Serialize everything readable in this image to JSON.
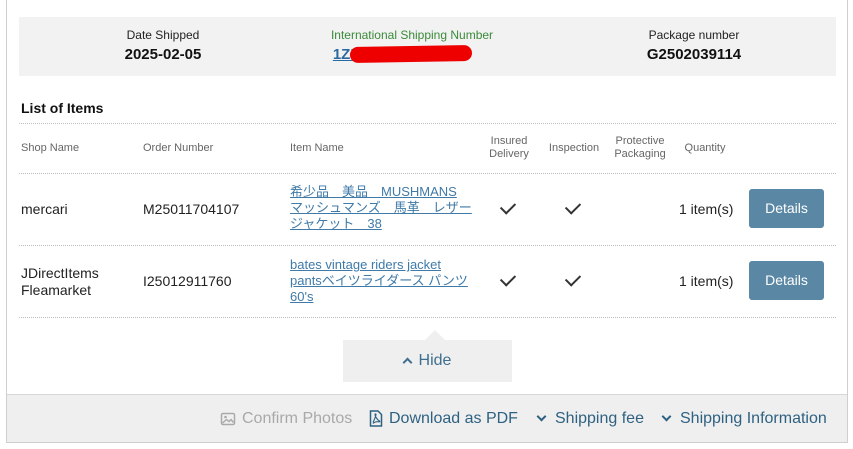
{
  "summary": {
    "date_label": "Date Shipped",
    "date_value": "2025-02-05",
    "intl_label": "International Shipping Number",
    "intl_value": "1ZR",
    "pkg_label": "Package number",
    "pkg_value": "G2502039114"
  },
  "list": {
    "title": "List of Items",
    "headers": {
      "shop": "Shop Name",
      "order": "Order Number",
      "item": "Item Name",
      "insured_1": "Insured",
      "insured_2": "Delivery",
      "inspection": "Inspection",
      "protective_1": "Protective",
      "protective_2": "Packaging",
      "quantity": "Quantity"
    },
    "rows": [
      {
        "shop": "mercari",
        "shop_2": "",
        "order": "M25011704107",
        "item_1": "希少品　美品　MUSHMANS",
        "item_2": "マッシュマンズ　馬革　レザー",
        "item_3": "ジャケット　38",
        "quantity": "1 item(s)",
        "details": "Details"
      },
      {
        "shop": "JDirectItems",
        "shop_2": "Fleamarket",
        "order": "I25012911760",
        "item_1": "bates vintage riders jacket",
        "item_2": "pantsベイツライダース パンツ",
        "item_3": "60's",
        "quantity": "1 item(s)",
        "details": "Details"
      }
    ]
  },
  "hide_label": "Hide",
  "footer": {
    "confirm_photos": "Confirm Photos",
    "download_pdf": "Download as PDF",
    "shipping_fee": "Shipping fee",
    "shipping_info": "Shipping Information"
  }
}
